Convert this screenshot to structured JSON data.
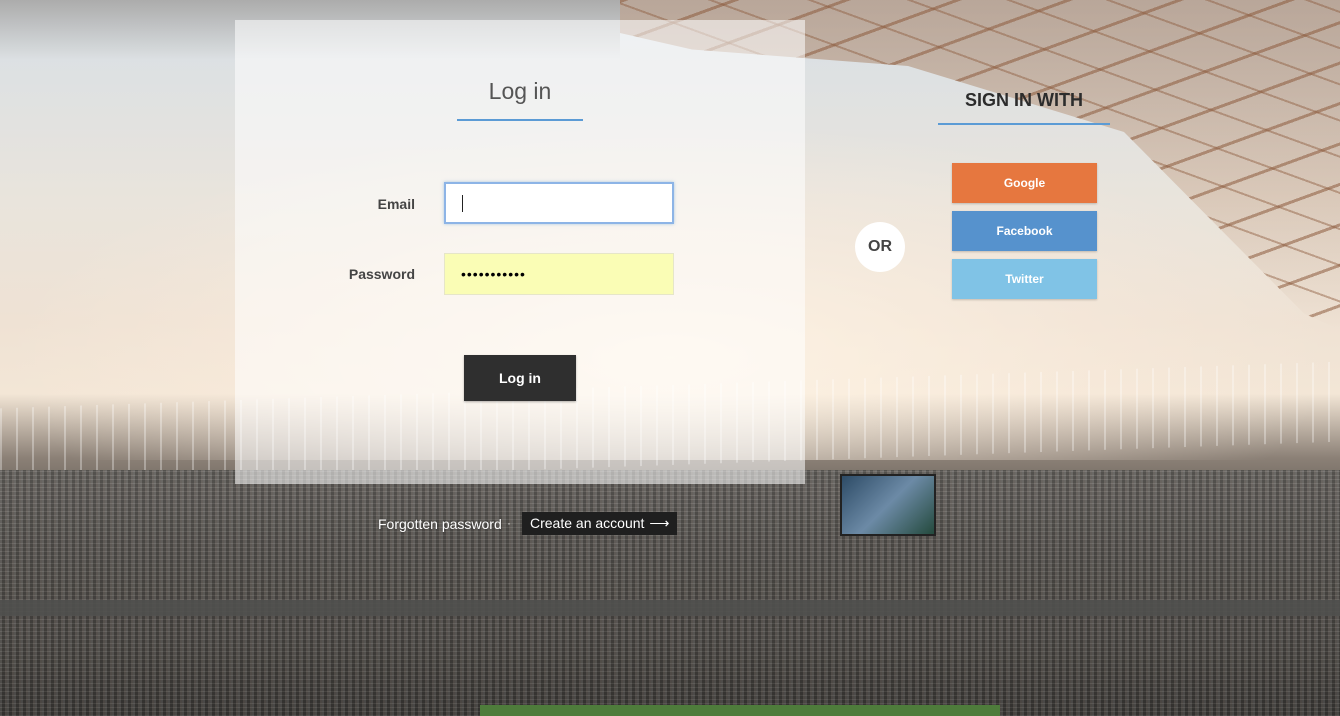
{
  "login": {
    "title": "Log in",
    "email_label": "Email",
    "email_value": "",
    "password_label": "Password",
    "password_value": "•••••••••••",
    "submit_label": "Log in"
  },
  "links": {
    "forgot_password": "Forgotten password",
    "separator": "·",
    "create_account": "Create an account",
    "create_arrow": "⟶"
  },
  "divider": {
    "or_label": "OR"
  },
  "social": {
    "title": "SIGN IN WITH",
    "buttons": [
      {
        "label": "Google",
        "color": "#e6773f"
      },
      {
        "label": "Facebook",
        "color": "#5692cd"
      },
      {
        "label": "Twitter",
        "color": "#80c3e6"
      }
    ]
  },
  "colors": {
    "accent": "#5b9bd5",
    "primary_button": "#2f2f2f",
    "autofill": "#fafdb5"
  }
}
